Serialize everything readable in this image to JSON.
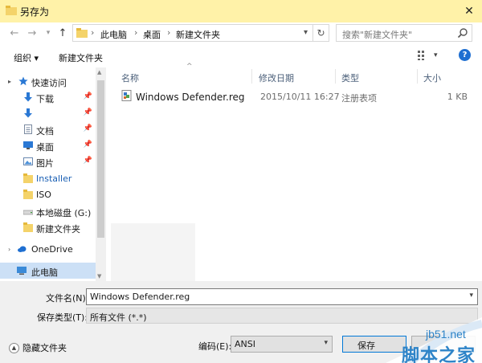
{
  "window": {
    "title": "另存为"
  },
  "address": {
    "crumbs": [
      "此电脑",
      "桌面",
      "新建文件夹"
    ],
    "sep": "›",
    "search_placeholder": "搜索\"新建文件夹\""
  },
  "toolbar": {
    "organize": "组织 ▾",
    "new_folder": "新建文件夹"
  },
  "sidebar": {
    "items": [
      {
        "label": "快速访问",
        "icon": "star-icon"
      },
      {
        "label": "下载",
        "icon": "download-icon",
        "pinned": true
      },
      {
        "label": "",
        "icon": "download-icon",
        "pinned": true
      },
      {
        "label": "文档",
        "icon": "document-icon",
        "pinned": true
      },
      {
        "label": "桌面",
        "icon": "desktop-icon",
        "pinned": true
      },
      {
        "label": "图片",
        "icon": "pictures-icon",
        "pinned": true
      },
      {
        "label": "Installer",
        "icon": "folder-icon"
      },
      {
        "label": "ISO",
        "icon": "folder-icon"
      },
      {
        "label": "本地磁盘 (G:)",
        "icon": "drive-icon"
      },
      {
        "label": "新建文件夹",
        "icon": "folder-icon"
      },
      {
        "label": "OneDrive",
        "icon": "cloud-icon"
      },
      {
        "label": "此电脑",
        "icon": "computer-icon"
      }
    ]
  },
  "columns": {
    "name": "名称",
    "modified": "修改日期",
    "type": "类型",
    "size": "大小"
  },
  "files": [
    {
      "name": "Windows Defender.reg",
      "modified": "2015/10/11 16:27",
      "type": "注册表项",
      "size": "1 KB"
    }
  ],
  "form": {
    "filename_label": "文件名(N):",
    "filename_value": "Windows Defender.reg",
    "filetype_label": "保存类型(T):",
    "filetype_value": "所有文件 (*.*)",
    "hide_folders": "隐藏文件夹",
    "encoding_label": "编码(E):",
    "encoding_value": "ANSI",
    "save_label": "保存"
  },
  "watermark": {
    "url": "jb51.net",
    "text": "脚本之家"
  },
  "colors": {
    "titlebar": "#fff2a8",
    "accent": "#0078d7",
    "selected": "#cce0f6",
    "folder": "#f4d36a",
    "watermark": "#2e84c8"
  }
}
